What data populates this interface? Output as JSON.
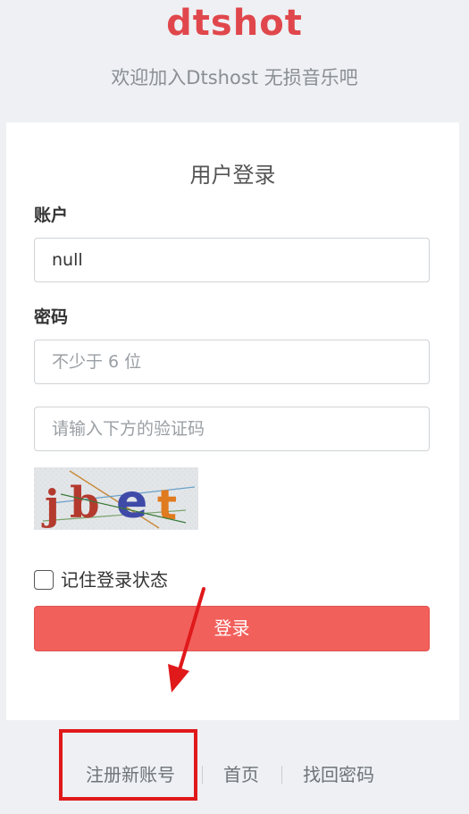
{
  "header": {
    "logo_text": "dtshot",
    "tagline": "欢迎加入Dtshost 无损音乐吧"
  },
  "login_form": {
    "title": "用户登录",
    "account": {
      "label": "账户",
      "value": "null"
    },
    "password": {
      "label": "密码",
      "placeholder": "不少于 6 位"
    },
    "captcha": {
      "placeholder": "请输入下方的验证码",
      "image_text": "jbet"
    },
    "remember": {
      "label": "记住登录状态",
      "checked": false
    },
    "submit_label": "登录"
  },
  "footer": {
    "links": [
      {
        "label": "注册新账号"
      },
      {
        "label": "首页"
      },
      {
        "label": "找回密码"
      }
    ]
  },
  "colors": {
    "brand": "#e0474c",
    "button": "#f2605c",
    "background": "#eef0f3",
    "annotation": "#e0191b"
  }
}
